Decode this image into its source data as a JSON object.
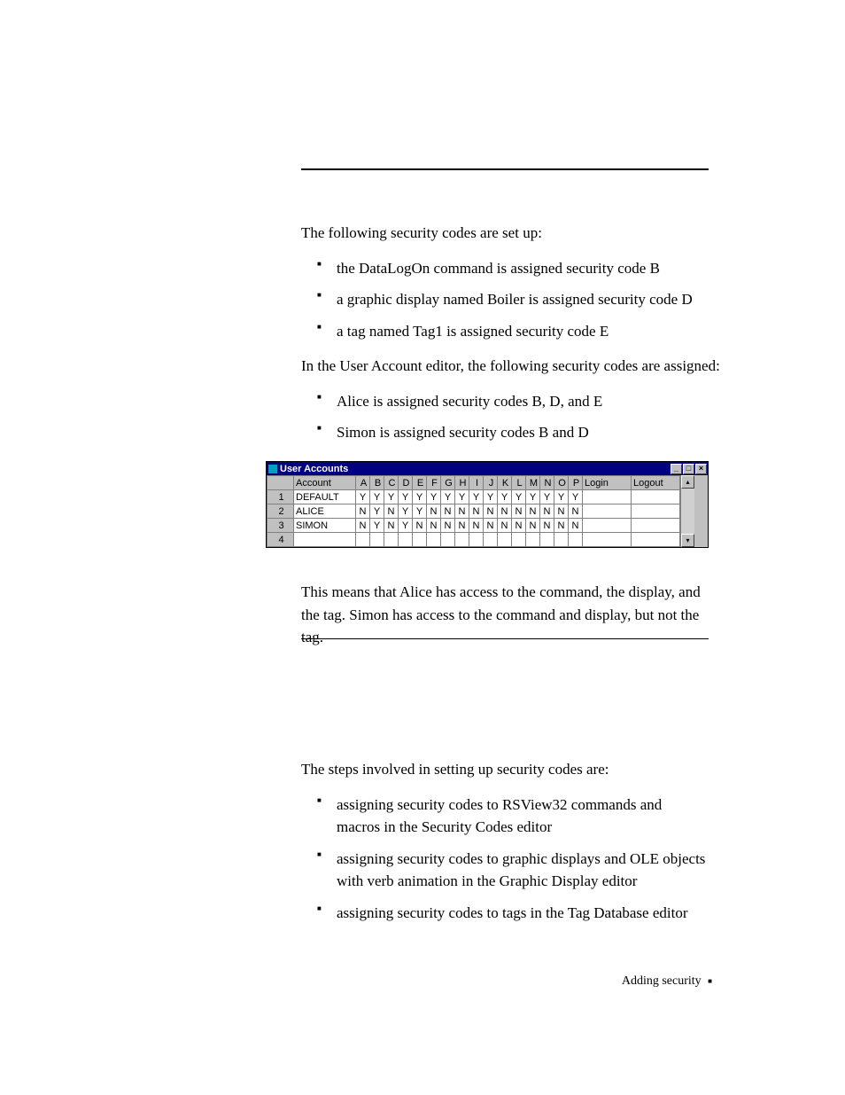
{
  "intro": "The following security codes are set up:",
  "bullets1": [
    "the DataLogOn command is assigned security code B",
    "a graphic display named Boiler is assigned security code D",
    "a tag named Tag1 is assigned security code E"
  ],
  "mid": "In the User Account editor, the following security codes are assigned:",
  "bullets2": [
    "Alice is assigned security codes B, D, and E",
    "Simon is assigned security codes B and D"
  ],
  "window": {
    "title": "User Accounts",
    "headers": {
      "account": "Account",
      "codes": [
        "A",
        "B",
        "C",
        "D",
        "E",
        "F",
        "G",
        "H",
        "I",
        "J",
        "K",
        "L",
        "M",
        "N",
        "O",
        "P"
      ],
      "login": "Login",
      "logout": "Logout"
    },
    "rows": [
      {
        "n": "1",
        "account": "DEFAULT",
        "codes": [
          "Y",
          "Y",
          "Y",
          "Y",
          "Y",
          "Y",
          "Y",
          "Y",
          "Y",
          "Y",
          "Y",
          "Y",
          "Y",
          "Y",
          "Y",
          "Y"
        ],
        "login": "",
        "logout": ""
      },
      {
        "n": "2",
        "account": "ALICE",
        "codes": [
          "N",
          "Y",
          "N",
          "Y",
          "Y",
          "N",
          "N",
          "N",
          "N",
          "N",
          "N",
          "N",
          "N",
          "N",
          "N",
          "N"
        ],
        "login": "",
        "logout": ""
      },
      {
        "n": "3",
        "account": "SIMON",
        "codes": [
          "N",
          "Y",
          "N",
          "Y",
          "N",
          "N",
          "N",
          "N",
          "N",
          "N",
          "N",
          "N",
          "N",
          "N",
          "N",
          "N"
        ],
        "login": "",
        "logout": ""
      },
      {
        "n": "4",
        "account": "",
        "codes": [
          "",
          "",
          "",
          "",
          "",
          "",
          "",
          "",
          "",
          "",
          "",
          "",
          "",
          "",
          "",
          ""
        ],
        "login": "",
        "logout": ""
      }
    ]
  },
  "after": "This means that Alice has access to the command, the display, and the tag. Simon has access to the command and display, but not the tag.",
  "lowerIntro": "The steps involved in setting up security codes are:",
  "bullets3": [
    "assigning security codes to RSView32 commands and macros in the Security Codes editor",
    "assigning security codes to graphic displays and OLE objects with verb animation in the Graphic Display editor",
    "assigning security codes to tags in the Tag Database editor"
  ],
  "footer": "Adding security"
}
